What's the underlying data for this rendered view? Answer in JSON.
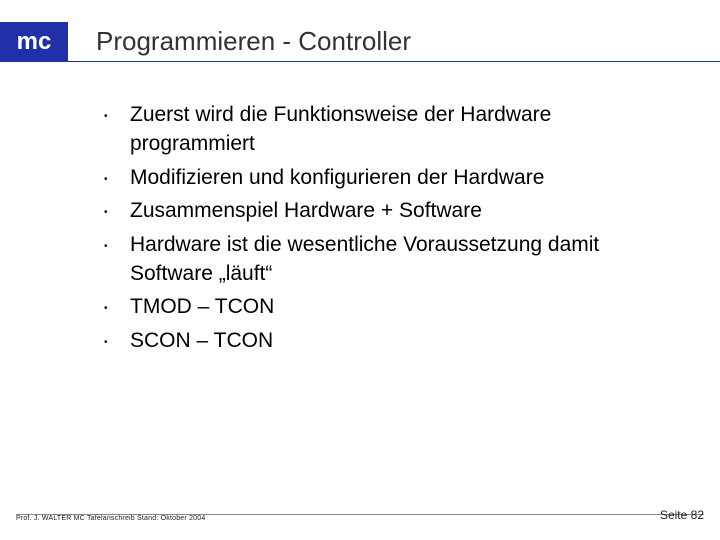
{
  "header": {
    "badge": "mc",
    "title": "Programmieren - Controller"
  },
  "bullets": [
    "Zuerst wird die Funktionsweise der Hardware programmiert",
    "Modifizieren und konfigurieren der Hardware",
    "Zusammenspiel Hardware + Software",
    "Hardware ist die wesentliche Voraussetzung damit Software „läuft“",
    "TMOD – TCON",
    "SCON – TCON"
  ],
  "footer": {
    "left": "Prof. J. WALTER  MC Tafelanschreib  Stand: Oktober 2004",
    "right": "Seite 82"
  }
}
